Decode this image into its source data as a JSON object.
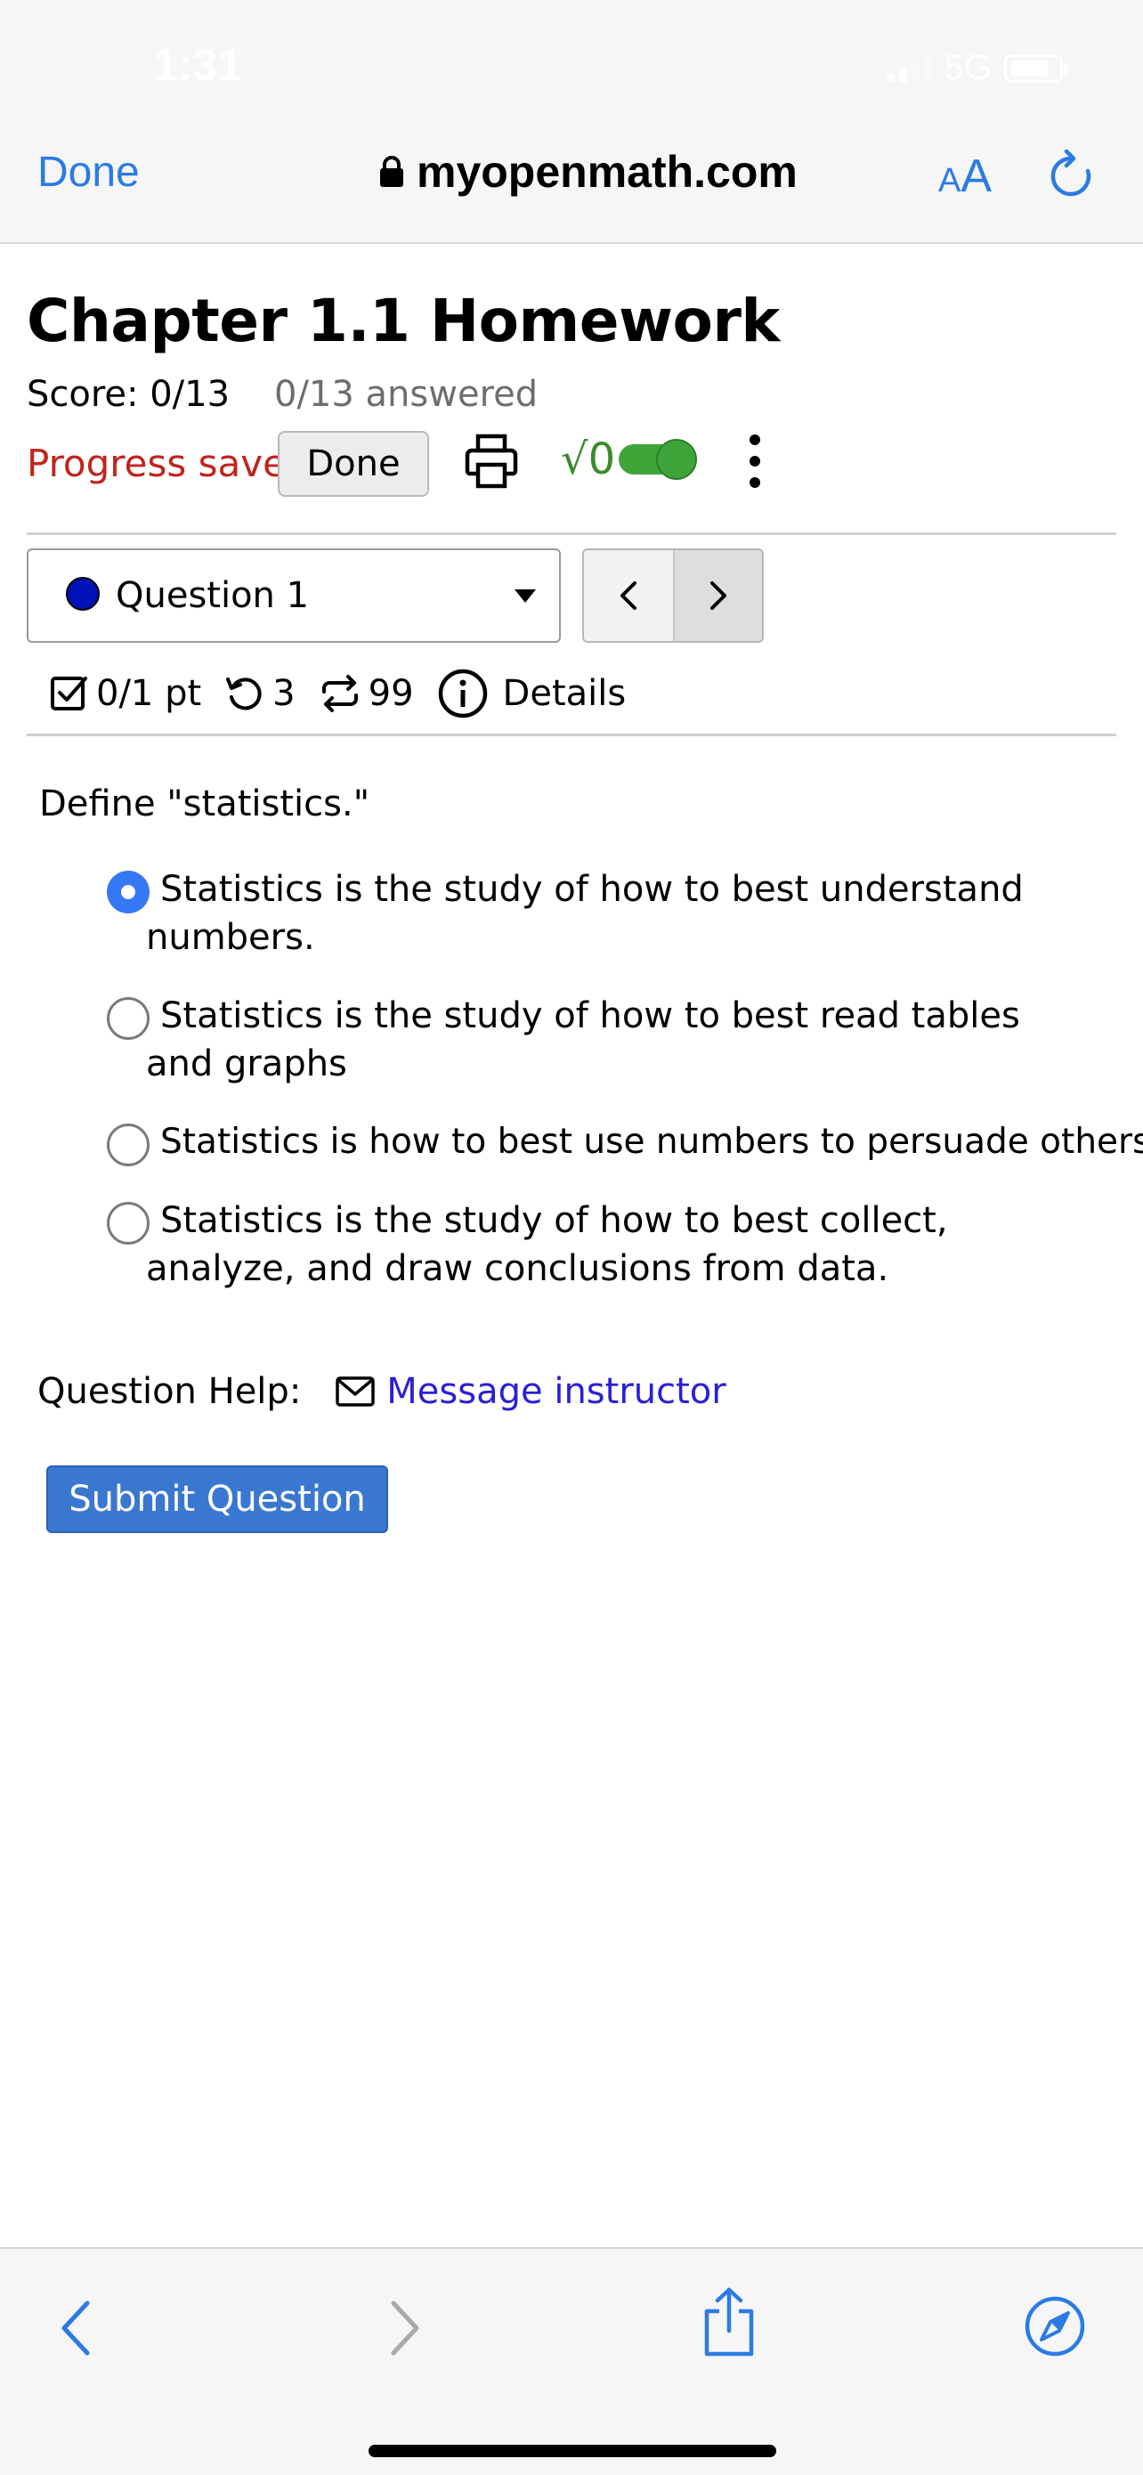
{
  "status_bar": {
    "time": "1:31",
    "network": "5G"
  },
  "browser": {
    "done_label": "Done",
    "url": "myopenmath.com",
    "text_size_small": "A",
    "text_size_large": "A"
  },
  "assignment": {
    "title": "Chapter 1.1 Homework",
    "score": "Score: 0/13",
    "answered": "0/13 answered",
    "progress_status": "Progress saved",
    "done_button": "Done",
    "math_toggle_label": "√0",
    "math_toggle_on": true
  },
  "question_nav": {
    "selected": "Question 1",
    "prev_symbol": "<",
    "next_symbol": ">"
  },
  "question_meta": {
    "points": "0/1 pt",
    "retries": "3",
    "regens": "99",
    "details_label": "Details"
  },
  "question": {
    "prompt": "Define \"statistics.\"",
    "options": [
      {
        "text": "Statistics is the study of how to best understand numbers.",
        "selected": true
      },
      {
        "text": "Statistics is the study of how to best read tables and graphs",
        "selected": false
      },
      {
        "text": "Statistics is how to best use numbers to persuade others",
        "selected": false
      },
      {
        "text": "Statistics is the study of how to best collect, analyze, and draw conclusions from data.",
        "selected": false
      }
    ]
  },
  "help": {
    "label": "Question Help:",
    "link_label": "Message instructor"
  },
  "submit_label": "Submit Question",
  "colors": {
    "ios_blue": "#2b7be4",
    "progress_red": "#c0241b",
    "submit_blue": "#3a77d1",
    "toggle_green": "#3fa43a",
    "link_purple": "#2a1fd6"
  }
}
